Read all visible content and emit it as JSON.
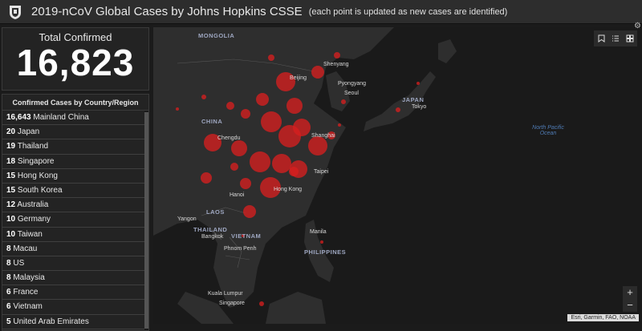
{
  "header": {
    "title": "2019-nCoV Global Cases by Johns Hopkins CSSE",
    "subtitle": "(each point is updated as new cases are identified)",
    "logo_icon": "university-shield-icon"
  },
  "total": {
    "label": "Total Confirmed",
    "value": "16,823"
  },
  "list": {
    "heading": "Confirmed Cases by Country/Region",
    "rows": [
      {
        "count": "16,643",
        "name": "Mainland China"
      },
      {
        "count": "20",
        "name": "Japan"
      },
      {
        "count": "19",
        "name": "Thailand"
      },
      {
        "count": "18",
        "name": "Singapore"
      },
      {
        "count": "15",
        "name": "Hong Kong"
      },
      {
        "count": "15",
        "name": "South Korea"
      },
      {
        "count": "12",
        "name": "Australia"
      },
      {
        "count": "10",
        "name": "Germany"
      },
      {
        "count": "10",
        "name": "Taiwan"
      },
      {
        "count": "8",
        "name": "Macau"
      },
      {
        "count": "8",
        "name": "US"
      },
      {
        "count": "8",
        "name": "Malaysia"
      },
      {
        "count": "6",
        "name": "France"
      },
      {
        "count": "6",
        "name": "Vietnam"
      },
      {
        "count": "5",
        "name": "United Arab Emirates"
      }
    ]
  },
  "map": {
    "labels": {
      "mongolia": "MONGOLIA",
      "china": "CHINA",
      "japan": "JAPAN",
      "laos": "LAOS",
      "thailand": "THAILAND",
      "vietnam": "VIETNAM",
      "philippines": "PHILIPPINES",
      "shenyang": "Shenyang",
      "beijing": "Beijing",
      "pyongyang": "Pyongyang",
      "seoul": "Seoul",
      "tokyo": "Tokyo",
      "chengdu": "Chengdu",
      "shanghai": "Shanghai",
      "taipei": "Taipei",
      "hongkong": "Hong Kong",
      "hanoi": "Hanoi",
      "yangon": "Yangon",
      "bangkok": "Bangkok",
      "manila": "Manila",
      "phnompenh": "Phnom Penh",
      "kualalumpur": "Kuala Lumpur",
      "singapore": "Singapore",
      "ocean": "North Pacific Ocean"
    },
    "attribution": "Esri, Garmin, FAO, NOAA",
    "zoom_in": "+",
    "zoom_out": "−",
    "tool_icons": [
      "bookmark-icon",
      "legend-list-icon",
      "basemap-gallery-icon"
    ],
    "point_color": "#d61f1f",
    "land_color": "#2e2e2e",
    "water_color": "#191919"
  }
}
